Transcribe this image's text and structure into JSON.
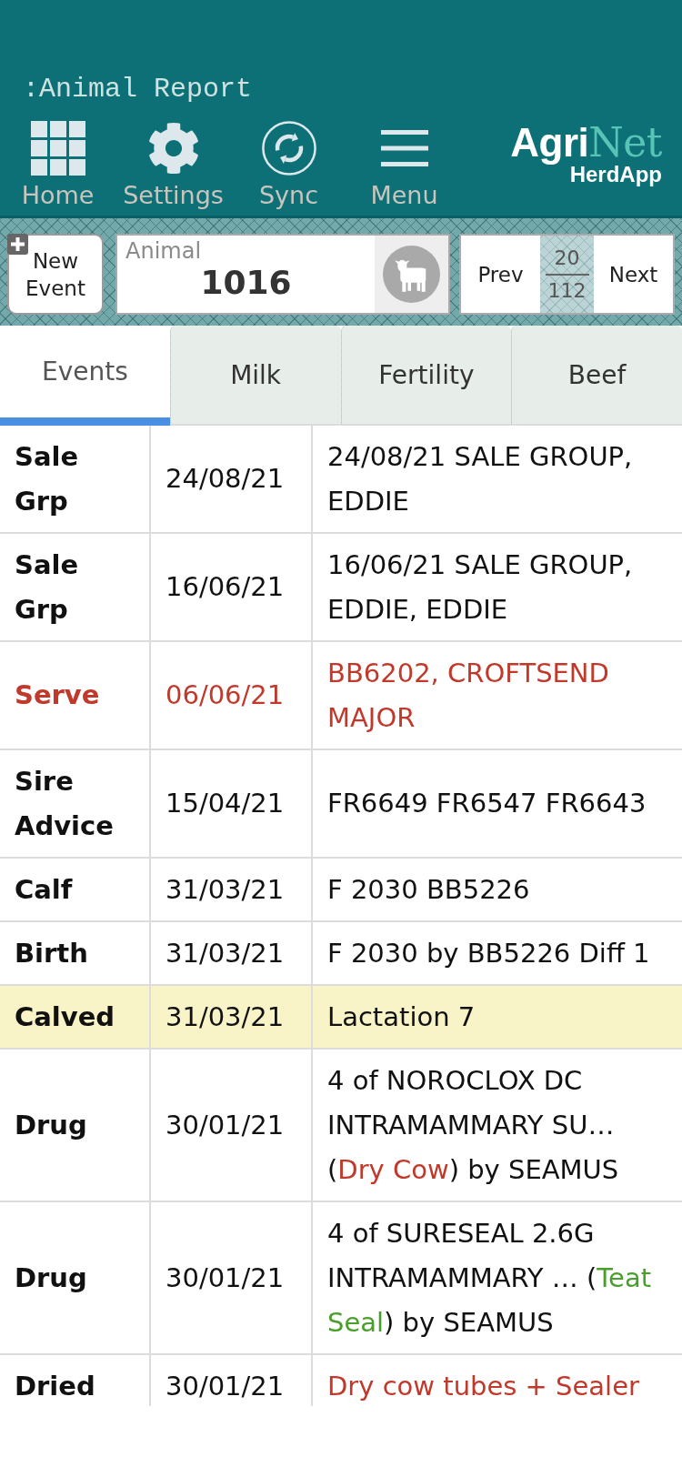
{
  "header": {
    "title": ":Animal Report",
    "nav": [
      {
        "label": "Home"
      },
      {
        "label": "Settings"
      },
      {
        "label": "Sync"
      },
      {
        "label": "Menu"
      }
    ],
    "brand": {
      "first": "Agri",
      "second": "Net",
      "product": "HerdApp"
    }
  },
  "toolbar": {
    "new_event": "New Event",
    "animal": {
      "label": "Animal",
      "value": "1016"
    },
    "pager": {
      "prev": "Prev",
      "current": "20",
      "total": "112",
      "next": "Next"
    }
  },
  "tabs": [
    {
      "label": "Events",
      "selected": true
    },
    {
      "label": "Milk",
      "selected": false
    },
    {
      "label": "Fertility",
      "selected": false
    },
    {
      "label": "Beef",
      "selected": false
    }
  ],
  "events": [
    {
      "type": "Sale Grp",
      "date": "24/08/21",
      "color": "#111111",
      "highlighted": false,
      "details": [
        {
          "text": "24/08/21 SALE GROUP, EDDIE",
          "color": "#111111"
        }
      ]
    },
    {
      "type": "Sale Grp",
      "date": "16/06/21",
      "color": "#111111",
      "highlighted": false,
      "details": [
        {
          "text": "16/06/21 SALE GROUP, EDDIE, EDDIE",
          "color": "#111111"
        }
      ]
    },
    {
      "type": "Serve",
      "date": "06/06/21",
      "color": "#c0392b",
      "highlighted": false,
      "details": [
        {
          "text": "BB6202, CROFTSEND MAJOR",
          "color": "#c0392b"
        }
      ]
    },
    {
      "type": "Sire Advice",
      "date": "15/04/21",
      "color": "#111111",
      "highlighted": false,
      "details": [
        {
          "text": "FR6649 FR6547 FR6643",
          "color": "#111111"
        }
      ]
    },
    {
      "type": "Calf",
      "date": "31/03/21",
      "color": "#111111",
      "highlighted": false,
      "details": [
        {
          "text": "F 2030 BB5226",
          "color": "#111111"
        }
      ]
    },
    {
      "type": "Birth",
      "date": "31/03/21",
      "color": "#111111",
      "highlighted": false,
      "details": [
        {
          "text": "F 2030 by BB5226 Diff 1",
          "color": "#111111"
        }
      ]
    },
    {
      "type": "Calved",
      "date": "31/03/21",
      "color": "#111111",
      "highlighted": true,
      "details": [
        {
          "text": "Lactation 7",
          "color": "#111111"
        }
      ]
    },
    {
      "type": "Drug",
      "date": "30/01/21",
      "color": "#111111",
      "highlighted": false,
      "details": [
        {
          "text": "4 of NOROCLOX DC INTRAMAMMARY SU… (",
          "color": "#111111"
        },
        {
          "text": "Dry Cow",
          "color": "#c0392b"
        },
        {
          "text": ") by SEAMUS",
          "color": "#111111"
        }
      ]
    },
    {
      "type": "Drug",
      "date": "30/01/21",
      "color": "#111111",
      "highlighted": false,
      "details": [
        {
          "text": "4 of SURESEAL 2.6G INTRAMAMMARY … (",
          "color": "#111111"
        },
        {
          "text": "Teat Seal",
          "color": "#4a9f2c"
        },
        {
          "text": ") by SEAMUS",
          "color": "#111111"
        }
      ]
    },
    {
      "type": "Dried",
      "date": "30/01/21",
      "color": "#111111",
      "highlighted": false,
      "details": [
        {
          "text": "Dry cow tubes + Sealer",
          "color": "#c0392b"
        }
      ]
    }
  ]
}
